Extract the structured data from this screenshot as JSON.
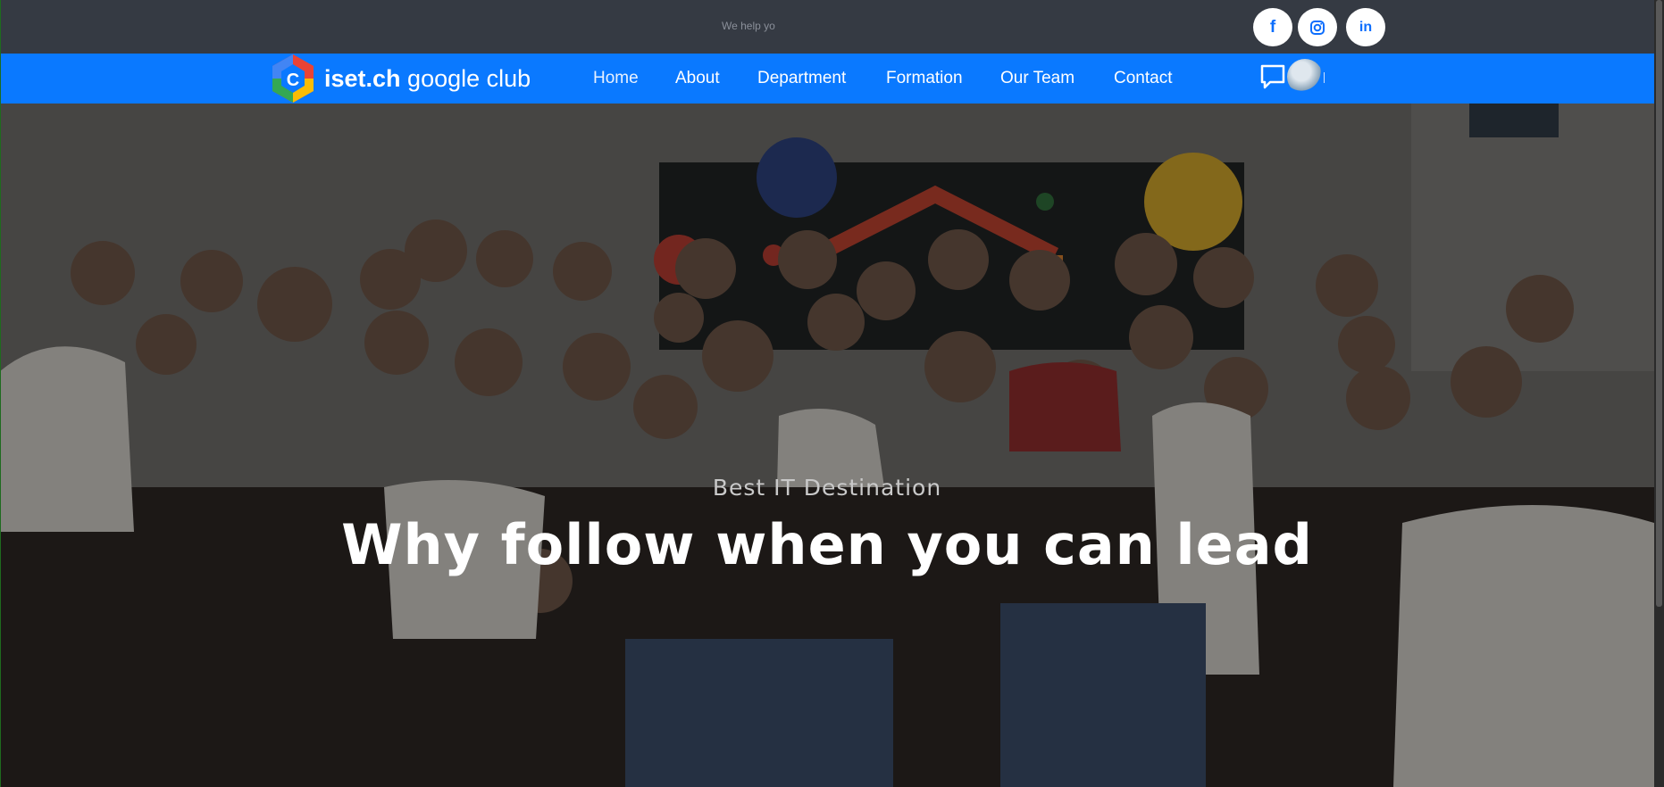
{
  "topbar": {
    "text": "We help yo",
    "social": [
      {
        "name": "facebook",
        "glyph": "f"
      },
      {
        "name": "instagram",
        "glyph": ""
      },
      {
        "name": "linkedin",
        "glyph": "in"
      }
    ]
  },
  "brand": {
    "name_bold": "iset.ch",
    "name_rest": " google club",
    "colors": {
      "blue": "#4285F4",
      "red": "#EA4335",
      "yellow": "#FBBC05",
      "green": "#34A853"
    }
  },
  "nav": {
    "items": [
      {
        "label": "Home",
        "active": true
      },
      {
        "label": "About"
      },
      {
        "label": "Department"
      },
      {
        "label": "Formation"
      },
      {
        "label": "Our Team"
      },
      {
        "label": "Contact"
      }
    ],
    "chat_icon": "chat-bubble-icon",
    "avatar": "user-avatar"
  },
  "hero": {
    "subtitle": "Best IT Destination",
    "title": "Why follow when you can lead"
  },
  "colors": {
    "navbar": "#0a79ff",
    "topbar": "#353a43"
  }
}
